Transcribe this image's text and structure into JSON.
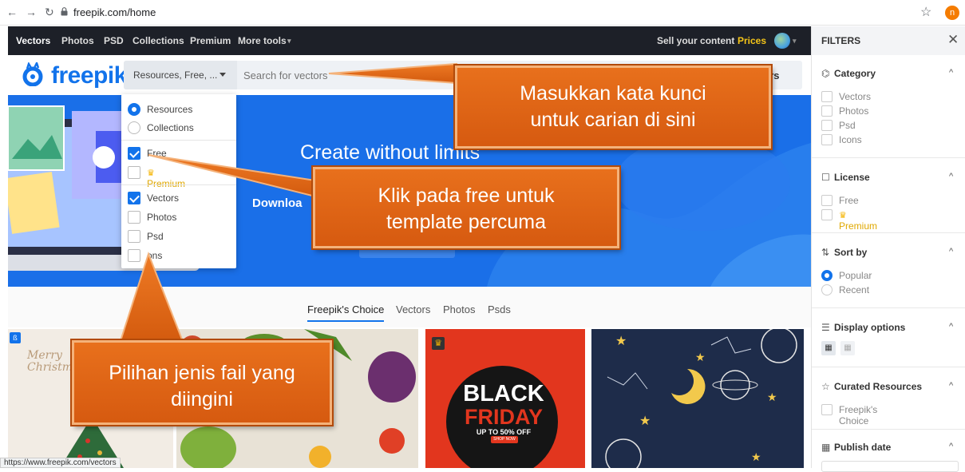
{
  "browser": {
    "url": "freepik.com/home",
    "profile_initial": "n",
    "status_url": "https://www.freepik.com/vectors"
  },
  "topnav": {
    "items": [
      "Vectors",
      "Photos",
      "PSD",
      "Collections",
      "Premium",
      "More tools"
    ],
    "sell": "Sell your content",
    "prices": "Prices"
  },
  "logo": "freepik",
  "search": {
    "dropdown_value": "Resources, Free, ...",
    "placeholder": "Search for vectors",
    "button_fragment": "ers"
  },
  "dropdown": {
    "resources": "Resources",
    "collections": "Collections",
    "free": "Free",
    "premium": "Premium",
    "vectors": "Vectors",
    "photos": "Photos",
    "psd": "Psd",
    "icons": "ons"
  },
  "banner": {
    "title": "Create without limits",
    "download": "Downloa"
  },
  "tabs": [
    "Freepik's Choice",
    "Vectors",
    "Photos",
    "Psds"
  ],
  "images": {
    "christmas_text": "Merry Christmas",
    "black_friday_line1": "BLACK",
    "black_friday_line2": "FRIDAY",
    "black_friday_offer": "UP TO 50% OFF",
    "black_friday_btn": "SHOP NOW"
  },
  "filters": {
    "title": "FILTERS",
    "category": {
      "title": "Category",
      "options": [
        "Vectors",
        "Photos",
        "Psd",
        "Icons"
      ]
    },
    "license": {
      "title": "License",
      "options": [
        "Free",
        "Premium"
      ]
    },
    "sort": {
      "title": "Sort by",
      "options": [
        "Popular",
        "Recent"
      ],
      "selected": "Popular"
    },
    "display": {
      "title": "Display options"
    },
    "curated": {
      "title": "Curated Resources",
      "options": [
        "Freepik's Choice"
      ]
    },
    "publish": {
      "title": "Publish date"
    }
  },
  "callouts": {
    "search": "Masukkan kata kunci untuk carian di sini",
    "free": "Klik pada free untuk template percuma",
    "filetype": "Pilihan jenis fail yang diingini"
  },
  "colors": {
    "brand": "#1273eb",
    "nav_dark": "#1d2028",
    "prices": "#f5c518",
    "callout": "#e8701c"
  }
}
